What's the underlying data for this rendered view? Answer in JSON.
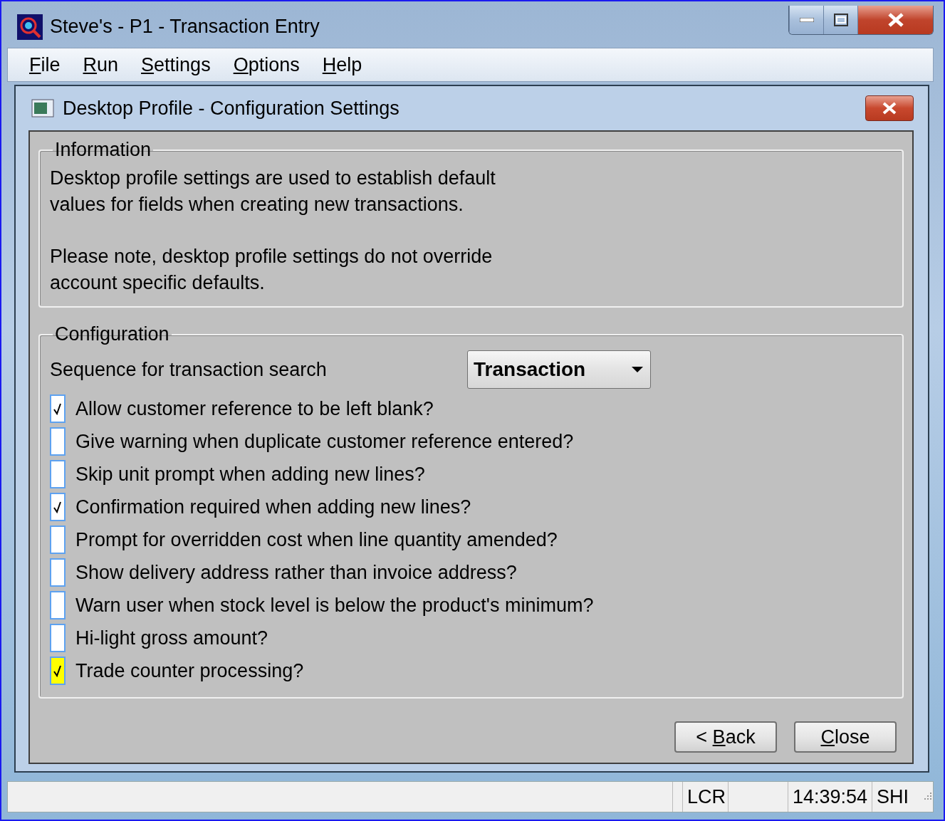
{
  "window": {
    "title": "Steve's - P1 - Transaction Entry"
  },
  "menu": [
    {
      "key": "F",
      "after": "ile"
    },
    {
      "key": "R",
      "after": "un"
    },
    {
      "key": "S",
      "after": "ettings"
    },
    {
      "key": "O",
      "after": "ptions"
    },
    {
      "key": "H",
      "after": "elp"
    }
  ],
  "dialog": {
    "title": "Desktop Profile - Configuration Settings"
  },
  "information": {
    "title": "Information",
    "paragraphs": [
      "Desktop profile settings are used to establish default\nvalues for fields when creating new transactions.",
      "Please note, desktop profile settings do not override\naccount specific defaults."
    ]
  },
  "configuration": {
    "title": "Configuration",
    "sequence_label": "Sequence for transaction search",
    "sequence_value": "Transaction",
    "options": [
      {
        "label": "Allow customer reference to be left blank?",
        "checked": true,
        "focused": false
      },
      {
        "label": "Give warning when duplicate customer reference entered?",
        "checked": false,
        "focused": false
      },
      {
        "label": "Skip unit prompt when adding new lines?",
        "checked": false,
        "focused": false
      },
      {
        "label": "Confirmation required when adding new lines?",
        "checked": true,
        "focused": false
      },
      {
        "label": "Prompt for overridden cost when line quantity amended?",
        "checked": false,
        "focused": false
      },
      {
        "label": "Show delivery address rather than invoice address?",
        "checked": false,
        "focused": false
      },
      {
        "label": "Warn user when stock level is below the product's minimum?",
        "checked": false,
        "focused": false
      },
      {
        "label": "Hi-light gross amount?",
        "checked": false,
        "focused": false
      },
      {
        "label": "Trade counter processing?",
        "checked": true,
        "focused": true
      }
    ]
  },
  "buttons": [
    {
      "before": "< ",
      "key": "B",
      "after": "ack"
    },
    {
      "key": "C",
      "after": "lose"
    }
  ],
  "status_bar": {
    "cells": [
      "LCR",
      "14:39:54",
      "SHI"
    ]
  }
}
